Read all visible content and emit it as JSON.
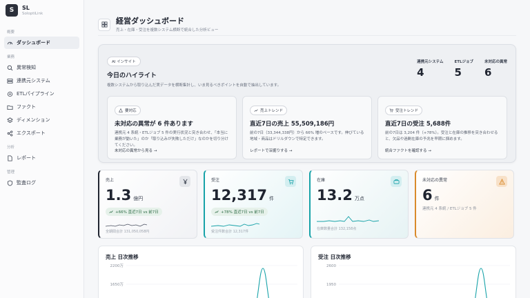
{
  "brand": {
    "initial": "S",
    "name": "SL",
    "sub": "SoloptiLink"
  },
  "nav": {
    "sections": [
      {
        "label": "概要",
        "items": [
          {
            "label": "ダッシュボード",
            "icon": "gauge-icon",
            "active": true
          }
        ]
      },
      {
        "label": "業務",
        "items": [
          {
            "label": "異常検知",
            "icon": "search-icon"
          },
          {
            "label": "連携元システム",
            "icon": "server-icon"
          },
          {
            "label": "ETLパイプライン",
            "icon": "pipeline-icon"
          },
          {
            "label": "ファクト",
            "icon": "folder-icon"
          },
          {
            "label": "ディメンション",
            "icon": "layers-icon"
          },
          {
            "label": "エクスポート",
            "icon": "share-icon"
          }
        ]
      },
      {
        "label": "分析",
        "items": [
          {
            "label": "レポート",
            "icon": "document-icon"
          }
        ]
      },
      {
        "label": "管理",
        "items": [
          {
            "label": "監査ログ",
            "icon": "shield-icon"
          }
        ]
      }
    ]
  },
  "header": {
    "title": "経営ダッシュボード",
    "subtitle": "売上・在庫・受注を複数システム横断で統合した分析ビュー"
  },
  "ai": {
    "badge": "AI インサイト",
    "title": "今日のハイライト",
    "description": "複数システムから取り込んだ実データを横断集計し、いま見るべきポイントを自動で抽出しています。",
    "stats": [
      {
        "label": "連携元システム",
        "value": "4"
      },
      {
        "label": "ETLジョブ",
        "value": "5"
      },
      {
        "label": "未対応の異常",
        "value": "6"
      }
    ],
    "insights": [
      {
        "tag": "要対応",
        "tag_icon": "alert-icon",
        "title": "未対応の異常が 6 件あります",
        "text": "連携元 4 系統・ETLジョブ 5 件の実行状況と突き合わせ、「本当に業務が動いた」のか「取り込みが失敗しただけ」なのかを切り分けてください。",
        "link": "未対応の異常から見る →"
      },
      {
        "tag": "売上トレンド",
        "tag_icon": "trend-icon",
        "title": "直近7日の売上 55,509,186円",
        "text": "前の7日（33,344,338円）から 66% 増のペースです。伸びている地域・商品はドリルダウンで特定できます。",
        "link": "レポートで深掘りする →"
      },
      {
        "tag": "受注トレンド",
        "tag_icon": "cart-icon",
        "title": "直近7日の受注 5,688件",
        "text": "前の7日は 3,204 件（+78%）。受注と在庫の推移を突き合わせると、欠品や過剰在庫の予兆を早期に掴めます。",
        "link": "統合ファクトを確認する →"
      }
    ]
  },
  "kpis": [
    {
      "label": "売上",
      "icon": "yen-icon",
      "value": "1.3",
      "unit": "億円",
      "trend": "+66% 直近7日 vs 前7日",
      "foot": "全期間合計 131,050,058円"
    },
    {
      "label": "受注",
      "icon": "cart-icon",
      "value": "12,317",
      "unit": "件",
      "trend": "+78% 直近7日 vs 前7日",
      "foot": "受注件数合計 12,317件"
    },
    {
      "label": "在庫",
      "icon": "box-icon",
      "value": "13.2",
      "unit": "万点",
      "foot": "在庫数量合計 132,158点"
    },
    {
      "label": "未対応の異常",
      "icon": "warning-icon",
      "value": "6",
      "unit": "件",
      "foot": "連携元 4 系統 / ETLジョブ 5 件"
    }
  ],
  "charts": [
    {
      "title": "売上 日次推移",
      "ticks": [
        "2200万",
        "1650万"
      ]
    },
    {
      "title": "受注 日次推移",
      "ticks": [
        "2600",
        "1950"
      ]
    }
  ],
  "colors": {
    "teal": "#17a2a8",
    "orange": "#d98a2b",
    "dark": "#1f2430"
  }
}
